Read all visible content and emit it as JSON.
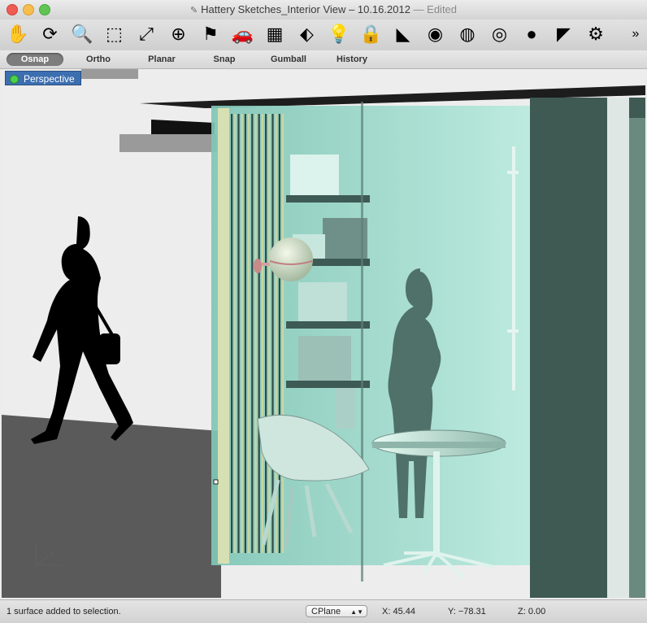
{
  "window": {
    "title": "Hattery Sketches_Interior View – 10.16.2012",
    "edited_label": "— Edited",
    "doc_icon": "✎"
  },
  "toolbar": {
    "tools": [
      {
        "name": "pan-hand-icon",
        "glyph": "✋"
      },
      {
        "name": "rotate-view-icon",
        "glyph": "⟳"
      },
      {
        "name": "zoom-icon",
        "glyph": "🔍"
      },
      {
        "name": "zoom-window-icon",
        "glyph": "⬚"
      },
      {
        "name": "zoom-extents-icon",
        "glyph": "⤢"
      },
      {
        "name": "zoom-selected-icon",
        "glyph": "⊕"
      },
      {
        "name": "named-view-icon",
        "glyph": "⚑"
      },
      {
        "name": "car-icon",
        "glyph": "🚗"
      },
      {
        "name": "cplane-icon",
        "glyph": "▦"
      },
      {
        "name": "select-points-icon",
        "glyph": "⬖"
      },
      {
        "name": "light-bulb-icon",
        "glyph": "💡"
      },
      {
        "name": "lock-icon",
        "glyph": "🔒"
      },
      {
        "name": "layers-icon",
        "glyph": "◣"
      },
      {
        "name": "color-wheel-icon",
        "glyph": "◉"
      },
      {
        "name": "wireframe-sphere-icon",
        "glyph": "◍"
      },
      {
        "name": "shaded-sphere-icon",
        "glyph": "◎"
      },
      {
        "name": "rendered-sphere-icon",
        "glyph": "●"
      },
      {
        "name": "render-icon",
        "glyph": "◤"
      },
      {
        "name": "settings-gear-icon",
        "glyph": "⚙"
      }
    ],
    "overflow_glyph": "»"
  },
  "modes": {
    "osnap": "Osnap",
    "ortho": "Ortho",
    "planar": "Planar",
    "snap": "Snap",
    "gumball": "Gumball",
    "history": "History"
  },
  "viewport": {
    "label": "Perspective",
    "axis_x": "x",
    "axis_y": "y"
  },
  "status": {
    "message": "1 surface added to selection.",
    "cplane": "CPlane",
    "x": "X: 45.44",
    "y": "Y: −78.31",
    "z": "Z: 0.00"
  },
  "colors": {
    "accent": "#3c6fb0",
    "glass": "#9fd9cc",
    "silhouette": "#000000",
    "floor": "#5a5a5a"
  }
}
